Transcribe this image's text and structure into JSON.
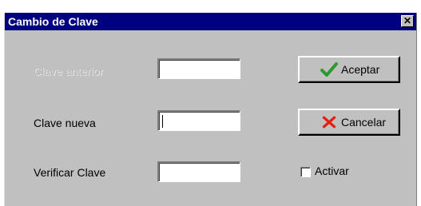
{
  "window": {
    "title": "Cambio de Clave",
    "close_glyph": "✕"
  },
  "form": {
    "old_password_label": "Clave anterior",
    "old_password_value": "",
    "new_password_label": "Clave nueva",
    "new_password_value": "",
    "verify_password_label": "Verificar Clave",
    "verify_password_value": ""
  },
  "buttons": {
    "accept_label": "Aceptar",
    "accept_icon": "checkmark-icon",
    "cancel_label": "Cancelar",
    "cancel_icon": "x-icon"
  },
  "options": {
    "activate_label": "Activar",
    "activate_checked": false
  },
  "colors": {
    "titlebar": "#000080",
    "window_face": "#c0c0c0",
    "accept_icon_color": "#2a9a2a",
    "cancel_icon_color": "#e02010"
  }
}
